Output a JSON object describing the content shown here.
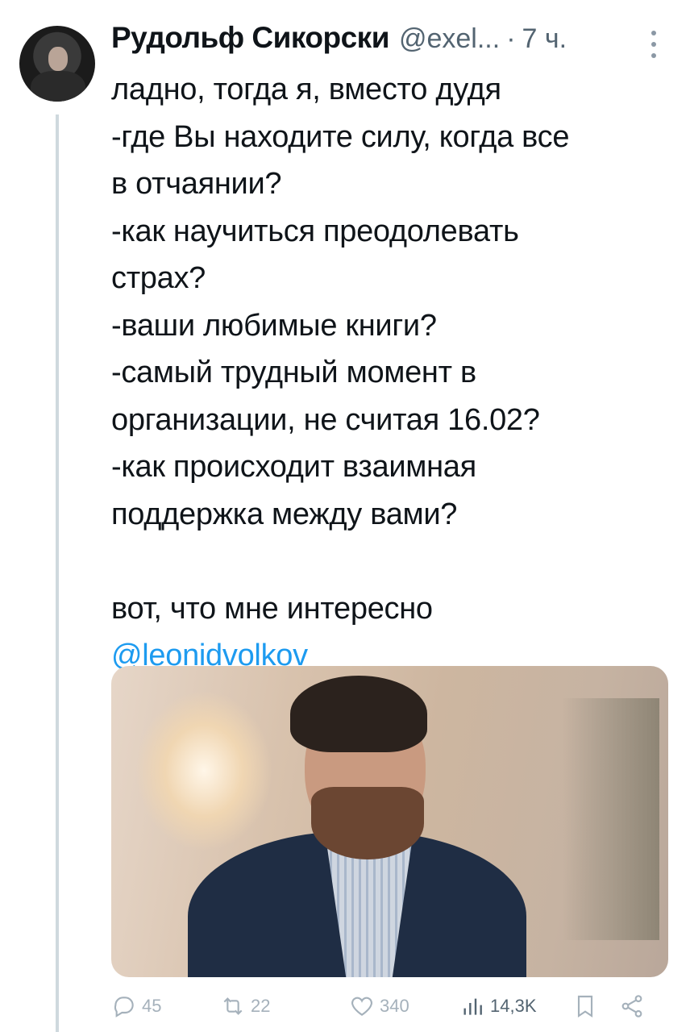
{
  "tweet": {
    "author_name": "Рудольф Сикорски",
    "handle": "@exel...",
    "separator": "·",
    "time": "7 ч.",
    "lines": [
      "ладно, тогда я, вместо дудя",
      "-где Вы находите силу, когда все",
      "в отчаянии?",
      "-как научиться преодолевать",
      "страх?",
      "-ваши любимые книги?",
      "-самый трудный момент в",
      "организации, не считая 16.02?",
      "-как происходит взаимная",
      "поддержка между вами?"
    ],
    "closing_line": "вот, что мне интересно",
    "mention": "@leonidvolkov"
  },
  "actions": {
    "replies": "45",
    "retweets": "22",
    "likes": "340",
    "views": "14,3K"
  },
  "icons": {
    "more": "more-vertical-icon",
    "reply": "reply-icon",
    "retweet": "retweet-icon",
    "like": "heart-icon",
    "views": "views-bar-chart-icon",
    "bookmark": "bookmark-icon",
    "share": "share-icon"
  },
  "colors": {
    "link": "#1d9bf0",
    "secondary_text": "#536471",
    "action_icons": "#a5b1bb"
  }
}
